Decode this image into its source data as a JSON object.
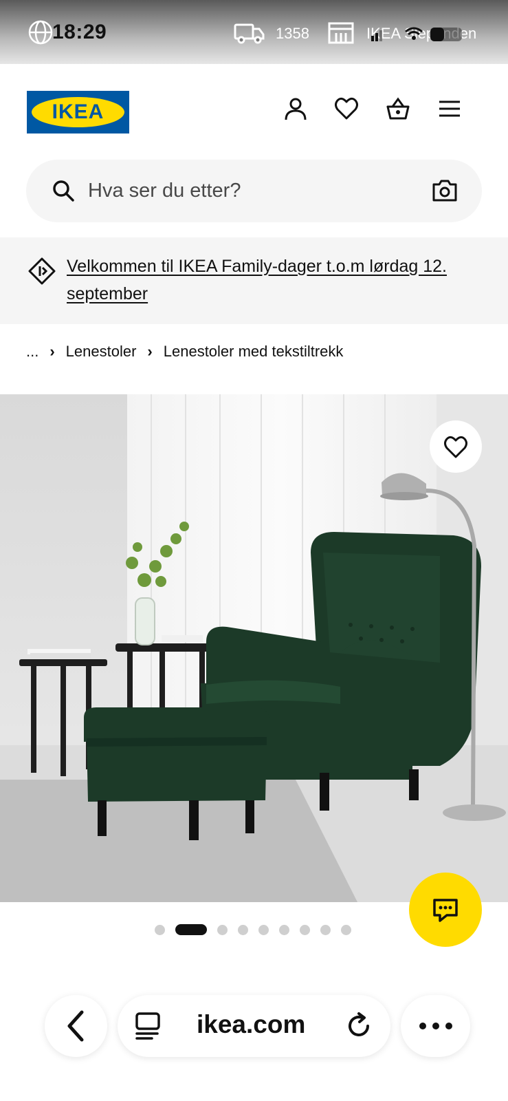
{
  "status_bar": {
    "time": "18:29",
    "postal_code": "1358",
    "store_name": "IKEA Slependen",
    "icons": [
      "globe-icon",
      "truck-icon",
      "store-icon",
      "signal-icon",
      "wifi-icon",
      "battery-icon"
    ]
  },
  "header": {
    "logo_text": "IKEA",
    "icons": [
      "profile-icon",
      "heart-icon",
      "basket-icon",
      "menu-icon"
    ],
    "brand_blue": "#0058a3",
    "brand_yellow": "#ffdb00"
  },
  "search": {
    "placeholder": "Hva ser du etter?",
    "value": ""
  },
  "promo": {
    "text": "Velkommen til IKEA Family-dager t.o.m lørdag 12. september"
  },
  "breadcrumb": {
    "items": [
      "...",
      "Lenestoler",
      "Lenestoler med tekstiltrekk"
    ]
  },
  "product_image": {
    "description_icon": "armchair-image",
    "chair_color": "#1c3a28"
  },
  "carousel": {
    "total": 9,
    "active_index": 1
  },
  "browser": {
    "url": "ikea.com",
    "icons": [
      "back-icon",
      "tabs-icon",
      "reload-icon",
      "more-icon"
    ]
  }
}
